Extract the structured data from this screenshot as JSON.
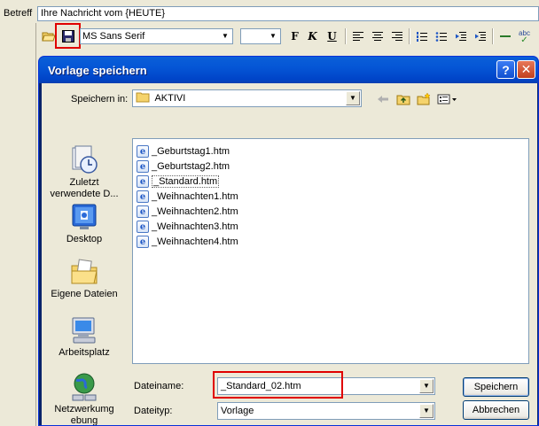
{
  "editor": {
    "subject_label": "Betreff",
    "subject_value": "Ihre Nachricht vom {HEUTE}",
    "font_name": "MS Sans Serif",
    "font_size": "",
    "bold_glyph": "F",
    "italic_glyph": "K",
    "underline_glyph": "U",
    "spell_glyph": "abc"
  },
  "dialog": {
    "title": "Vorlage speichern",
    "help_glyph": "?",
    "close_glyph": "✕",
    "save_in_label": "Speichern in:",
    "save_in_value": "AKTIVI",
    "places": [
      {
        "name": "recent",
        "label": "Zuletzt verwendete D..."
      },
      {
        "name": "desktop",
        "label": "Desktop"
      },
      {
        "name": "documents",
        "label": "Eigene Dateien"
      },
      {
        "name": "computer",
        "label": "Arbeitsplatz"
      },
      {
        "name": "network",
        "label": "Netzwerkumgebung"
      }
    ],
    "files": [
      "_Geburtstag1.htm",
      "_Geburtstag2.htm",
      "_Standard.htm",
      "_Weihnachten1.htm",
      "_Weihnachten2.htm",
      "_Weihnachten3.htm",
      "_Weihnachten4.htm"
    ],
    "selected_file": "_Standard.htm",
    "filename_label": "Dateiname:",
    "filename_value": "_Standard_02.htm",
    "filetype_label": "Dateityp:",
    "filetype_value": "Vorlage",
    "save_button": "Speichern",
    "cancel_button": "Abbrechen"
  },
  "colors": {
    "highlight": "#e00000",
    "titlebar": "#0054e3"
  }
}
